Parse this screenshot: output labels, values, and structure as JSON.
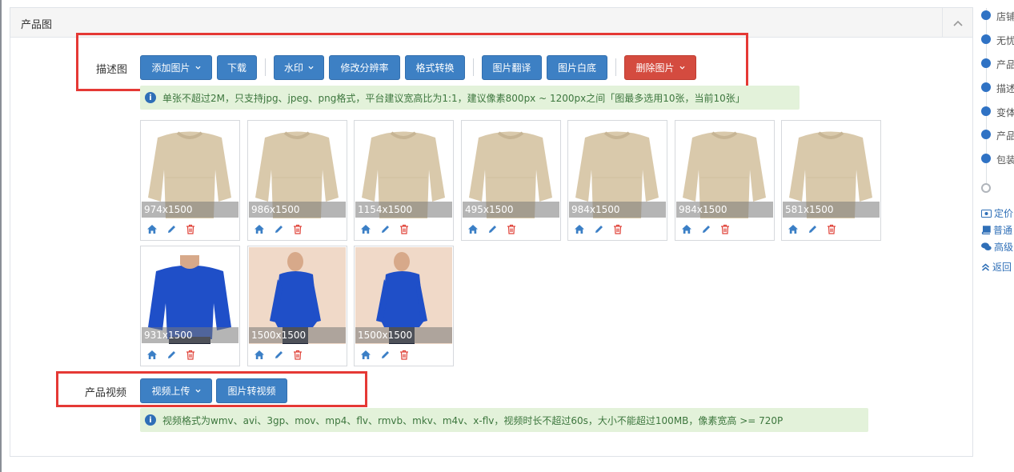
{
  "panel": {
    "title": "产品图"
  },
  "desc_row": {
    "label": "描述图",
    "buttons": {
      "add_image": "添加图片",
      "download": "下载",
      "watermark": "水印",
      "resize": "修改分辨率",
      "format_convert": "格式转换",
      "translate": "图片翻译",
      "white_bg": "图片白底",
      "delete_image": "删除图片"
    },
    "tip": "单张不超过2M，只支持jpg、jpeg、png格式，平台建议宽高比为1:1，建议像素800px ~ 1200px之间「图最多选用10张，当前10张」"
  },
  "images": [
    {
      "size": "974x1500",
      "kind": "beige"
    },
    {
      "size": "986x1500",
      "kind": "beige"
    },
    {
      "size": "1154x1500",
      "kind": "beige"
    },
    {
      "size": "495x1500",
      "kind": "beige"
    },
    {
      "size": "984x1500",
      "kind": "beige"
    },
    {
      "size": "984x1500",
      "kind": "beige"
    },
    {
      "size": "581x1500",
      "kind": "beige"
    },
    {
      "size": "931x1500",
      "kind": "blue"
    },
    {
      "size": "1500x1500",
      "kind": "blue"
    },
    {
      "size": "1500x1500",
      "kind": "blue"
    }
  ],
  "video_row": {
    "label": "产品视频",
    "buttons": {
      "upload_video": "视频上传",
      "image_to_video": "图片转视频"
    },
    "tip": "视频格式为wmv、avi、3gp、mov、mp4、flv、rmvb、mkv、m4v、x-flv，视频时长不超过60s，大小不能超过100MB，像素宽高 >= 720P"
  },
  "side_nav": {
    "items": [
      "店铺",
      "无忧",
      "产品",
      "描述",
      "变体",
      "产品",
      "包装"
    ],
    "links": [
      "定价",
      "普通",
      "高级",
      "返回"
    ]
  },
  "colors": {
    "primary": "#3d80c4",
    "danger": "#d44b3f",
    "tip_bg": "#e3f2da",
    "tip_text": "#3c763d",
    "highlight_box": "#e53935"
  },
  "icons": {
    "info": "i",
    "home": "home-icon",
    "edit": "pencil-icon",
    "delete": "trash-icon"
  }
}
